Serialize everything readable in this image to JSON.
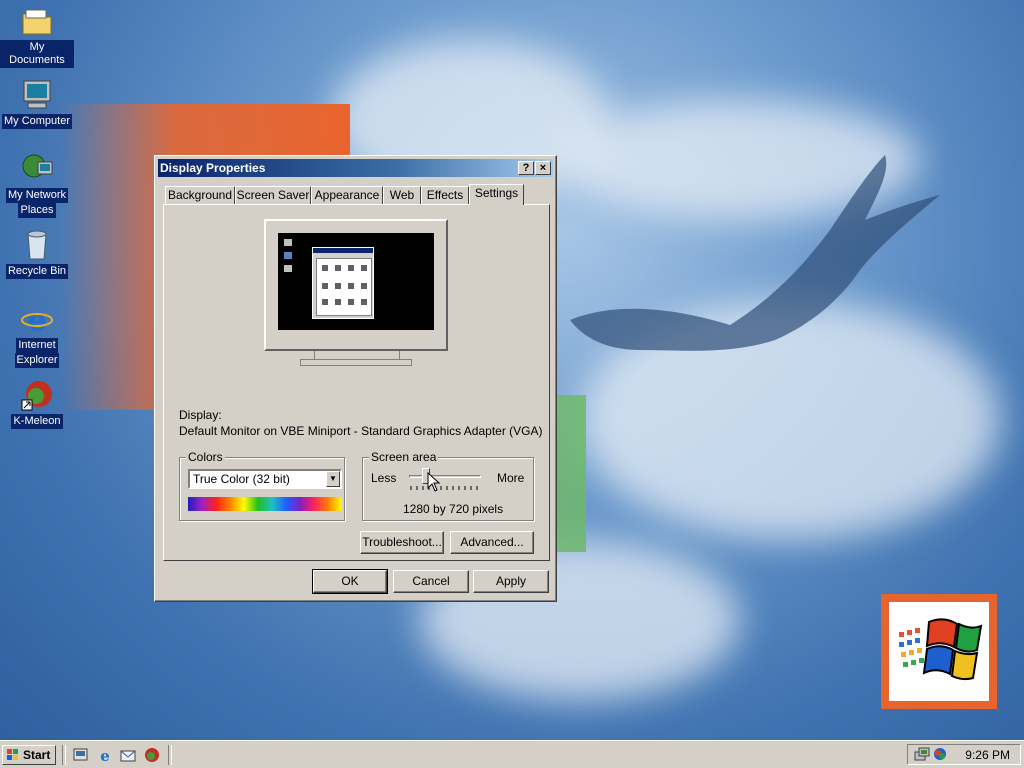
{
  "desktop": {
    "icons": [
      {
        "label_line1": "My Documents",
        "label_line2": ""
      },
      {
        "label_line1": "My Computer",
        "label_line2": ""
      },
      {
        "label_line1": "My Network",
        "label_line2": "Places"
      },
      {
        "label_line1": "Recycle Bin",
        "label_line2": ""
      },
      {
        "label_line1": "Internet",
        "label_line2": "Explorer"
      },
      {
        "label_line1": "K-Meleon",
        "label_line2": ""
      }
    ]
  },
  "dialog": {
    "title": "Display Properties",
    "help_button": "?",
    "close_button": "×",
    "tabs": [
      "Background",
      "Screen Saver",
      "Appearance",
      "Web",
      "Effects",
      "Settings"
    ],
    "active_tab": "Settings",
    "display_label": "Display:",
    "display_value": "Default Monitor on VBE Miniport - Standard Graphics Adapter (VGA)",
    "colors": {
      "legend": "Colors",
      "selected": "True Color (32 bit)"
    },
    "screen_area": {
      "legend": "Screen area",
      "less": "Less",
      "more": "More",
      "value_text": "1280 by 720 pixels",
      "slider_level": 0.2
    },
    "buttons": {
      "troubleshoot": "Troubleshoot...",
      "advanced": "Advanced...",
      "ok": "OK",
      "cancel": "Cancel",
      "apply": "Apply"
    }
  },
  "taskbar": {
    "start_label": "Start",
    "clock": "9:26 PM"
  },
  "colors": {
    "titlebar_start": "#0a246a",
    "titlebar_end": "#a6caf0",
    "face": "#d4d0c8",
    "selection": "#0a246a"
  }
}
